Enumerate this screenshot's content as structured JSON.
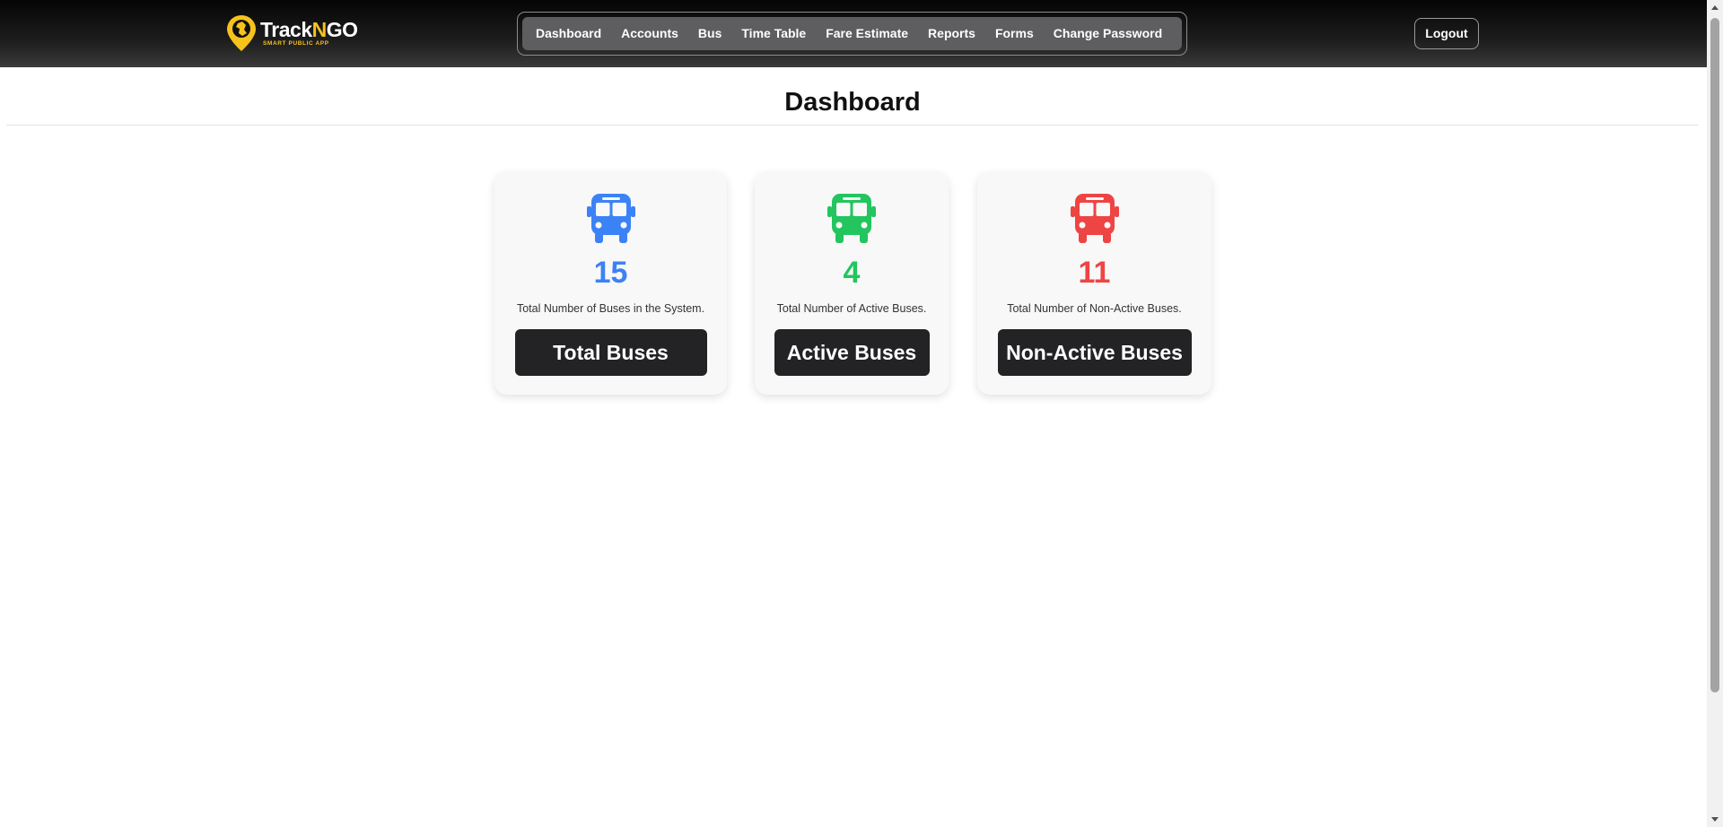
{
  "brand": {
    "name_prefix": "Track",
    "name_highlight": "N",
    "name_suffix": "GO",
    "tagline": "SMART PUBLIC APP",
    "accent_color": "#f6c21c"
  },
  "nav": {
    "items": [
      {
        "label": "Dashboard",
        "name": "nav-dashboard"
      },
      {
        "label": "Accounts",
        "name": "nav-accounts"
      },
      {
        "label": "Bus",
        "name": "nav-bus"
      },
      {
        "label": "Time Table",
        "name": "nav-time-table"
      },
      {
        "label": "Fare Estimate",
        "name": "nav-fare-estimate"
      },
      {
        "label": "Reports",
        "name": "nav-reports"
      },
      {
        "label": "Forms",
        "name": "nav-forms"
      },
      {
        "label": "Change Password",
        "name": "nav-change-password"
      }
    ],
    "logout_label": "Logout"
  },
  "page": {
    "title": "Dashboard"
  },
  "cards": [
    {
      "icon": "bus-icon",
      "color": "#3b82f6",
      "count": "15",
      "description": "Total Number of Buses in the System.",
      "button_label": "Total Buses"
    },
    {
      "icon": "bus-icon",
      "color": "#22c55e",
      "count": "4",
      "description": "Total Number of Active Buses.",
      "button_label": "Active Buses"
    },
    {
      "icon": "bus-icon",
      "color": "#ef4444",
      "count": "11",
      "description": "Total Number of Non-Active Buses.",
      "button_label": "Non-Active Buses"
    }
  ]
}
